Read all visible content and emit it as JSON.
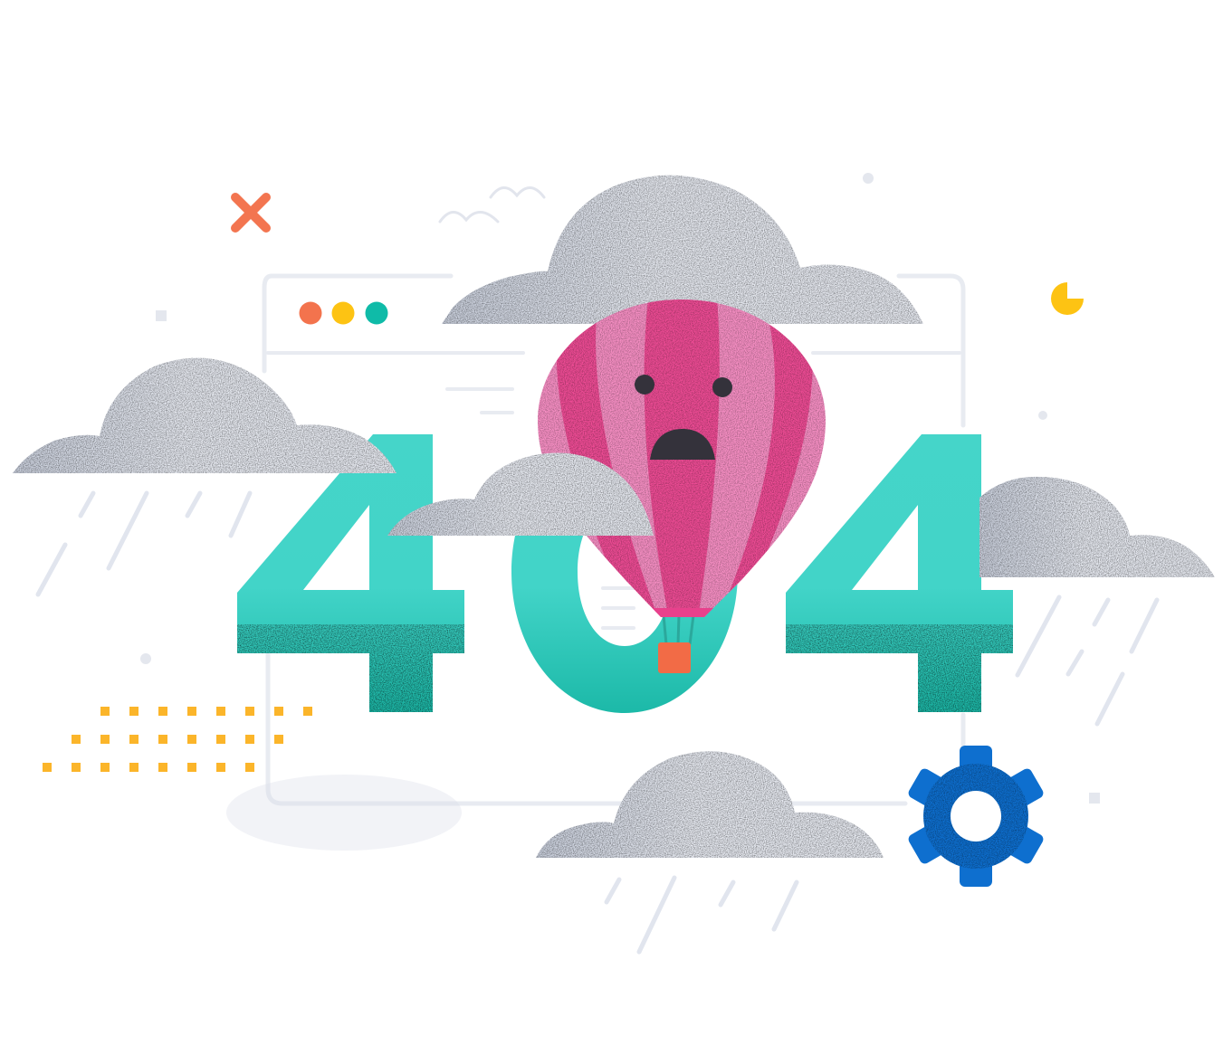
{
  "illustration": {
    "error_code_digits": [
      "4",
      "0",
      "4"
    ],
    "colors": {
      "digits": "#42d4c8",
      "digits_texture": "#14b7a5",
      "cloud": "#e6e9f0",
      "cloud_texture": "#c5cad8",
      "rain": "#e1e5ee",
      "window_frame": "#e8ebf1",
      "balloon_light": "#f78fc4",
      "balloon_dark": "#ee4c95",
      "balloon_face": "#34323b",
      "basket": "#f26b46",
      "ropes": "#2ba89c",
      "gear": "#0e6fcf",
      "x_mark": "#f37550",
      "pie_mark": "#fdc313",
      "dot_grid": "#fbb52a",
      "window_dot_red": "#f3734d",
      "window_dot_yellow": "#fdc313",
      "window_dot_teal": "#0fbba8"
    },
    "icons": [
      "balloon-sad-face",
      "gear-icon",
      "close-x-icon",
      "pie-icon",
      "bird-icon",
      "cloud",
      "browser-window"
    ]
  }
}
